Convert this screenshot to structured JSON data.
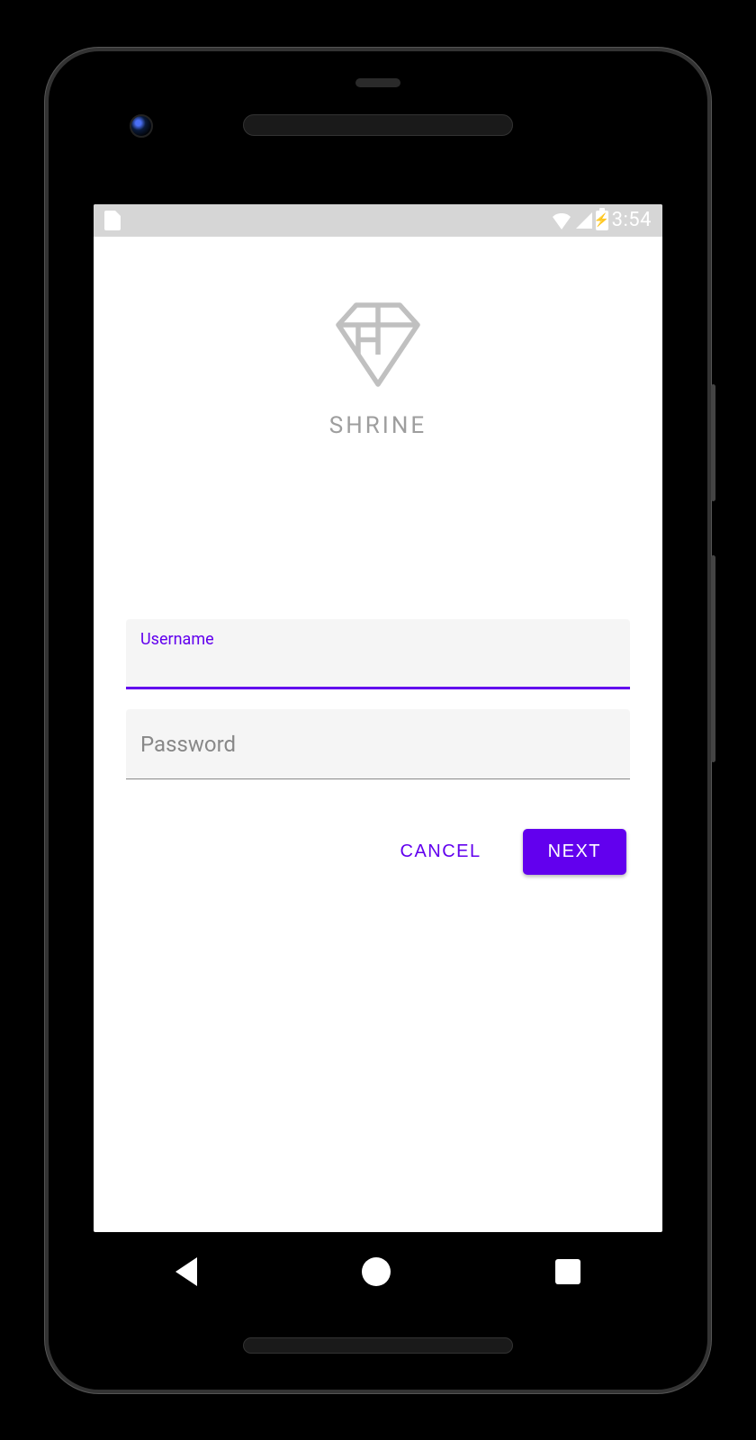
{
  "status_bar": {
    "time": "3:54"
  },
  "logo": {
    "title": "SHRINE"
  },
  "form": {
    "username": {
      "label": "Username",
      "value": ""
    },
    "password": {
      "placeholder": "Password",
      "value": ""
    }
  },
  "buttons": {
    "cancel": "CANCEL",
    "next": "NEXT"
  },
  "colors": {
    "primary": "#6200ee",
    "surface": "#f5f5f5",
    "hint": "#9e9e9e"
  }
}
